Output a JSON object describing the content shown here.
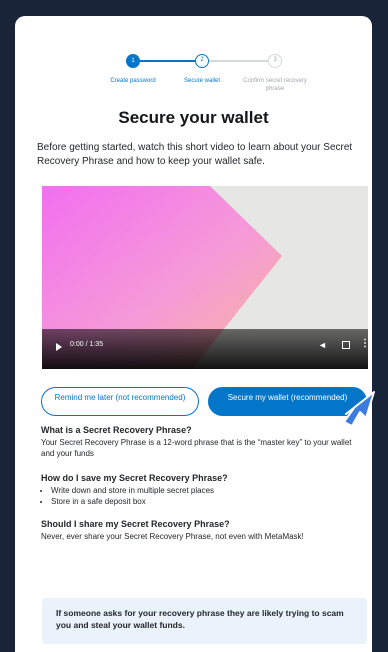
{
  "stepper": {
    "steps": [
      {
        "number": "1",
        "label": "Create password"
      },
      {
        "number": "2",
        "label": "Secure wallet"
      },
      {
        "number": "3",
        "label": "Confirm secret recovery phrase"
      }
    ]
  },
  "title": "Secure your wallet",
  "intro": "Before getting started, watch this short video to learn about your Secret Recovery Phrase and how to keep your wallet safe.",
  "video": {
    "time": "0:00 / 1:35",
    "icons": [
      "play-icon",
      "volume-icon",
      "fullscreen-icon",
      "more-options-icon"
    ]
  },
  "buttons": {
    "later": "Remind me later (not recommended)",
    "secure": "Secure my wallet (recommended)"
  },
  "faq": [
    {
      "question": "What is a Secret Recovery Phrase?",
      "answer": "Your Secret Recovery Phrase is a 12-word phrase that is the “master key” to your wallet and your funds"
    },
    {
      "question": "How do I save my Secret Recovery Phrase?",
      "bullets": [
        "Write down and store in multiple secret places",
        "Store in a safe deposit box"
      ]
    },
    {
      "question": "Should I share my Secret Recovery Phrase?",
      "answer": "Never, ever share your Secret Recovery Phrase, not even with MetaMask!"
    }
  ],
  "alert": "If someone asks for your recovery phrase they are likely trying to scam you and steal your wallet funds.",
  "colors": {
    "primary": "#0376c9",
    "background": "#1a2438",
    "alert_bg": "#eaf2fb"
  }
}
